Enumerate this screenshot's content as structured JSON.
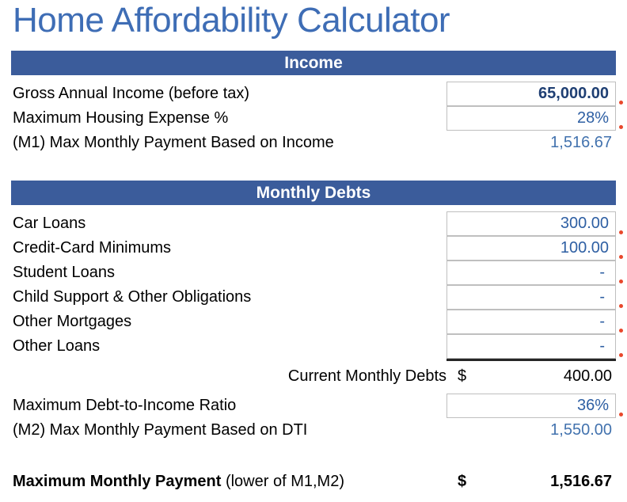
{
  "page": {
    "title": "Home Affordability Calculator",
    "accent_color": "#3B5C9B",
    "title_color": "#3E6DB5",
    "value_color": "#4272AE",
    "comment_marker_color": "#E8472B"
  },
  "income": {
    "header": "Income",
    "rows": [
      {
        "label": "Gross Annual Income (before tax)",
        "value": "65,000.00",
        "kind": "input",
        "bold": true,
        "comment": true
      },
      {
        "label": "Maximum Housing Expense %",
        "value": "28%",
        "kind": "input",
        "bold": false,
        "comment": true
      },
      {
        "label": "(M1) Max Monthly Payment Based on Income",
        "value": "1,516.67",
        "kind": "calc",
        "bold": false,
        "comment": false
      }
    ]
  },
  "monthly_debts": {
    "header": "Monthly Debts",
    "rows": [
      {
        "label": "Car Loans",
        "value": "300.00",
        "kind": "input",
        "bold": false,
        "comment": true
      },
      {
        "label": "Credit-Card Minimums",
        "value": "100.00",
        "kind": "input",
        "bold": false,
        "comment": true
      },
      {
        "label": "Student Loans",
        "value": "-",
        "kind": "input",
        "bold": false,
        "comment": true
      },
      {
        "label": "Child Support & Other Obligations",
        "value": "-",
        "kind": "input",
        "bold": false,
        "comment": true
      },
      {
        "label": "Other Mortgages",
        "value": "-",
        "kind": "input",
        "bold": false,
        "comment": true
      },
      {
        "label": "Other Loans",
        "value": "-",
        "kind": "input",
        "bold": false,
        "comment": true
      }
    ],
    "total": {
      "label": "Current Monthly Debts",
      "currency": "$",
      "value": "400.00"
    },
    "dti_row": {
      "label": "Maximum Debt-to-Income Ratio",
      "value": "36%",
      "kind": "input",
      "comment": true
    },
    "m2_row": {
      "label": "(M2) Max Monthly Payment Based on DTI",
      "value": "1,550.00",
      "kind": "calc"
    }
  },
  "result": {
    "label_bold": "Maximum Monthly Payment",
    "label_regular": " (lower of M1,M2)",
    "currency": "$",
    "value": "1,516.67"
  }
}
